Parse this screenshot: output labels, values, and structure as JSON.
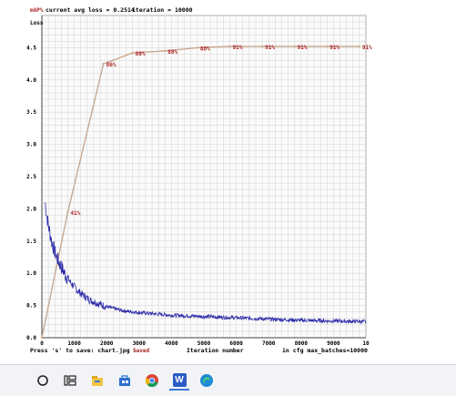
{
  "chart_data": {
    "type": "line",
    "header": {
      "current_avg_loss": "current avg loss = 0.2514",
      "iteration": "iteration = 10000"
    },
    "legend": {
      "map": "mAP%",
      "loss": "Loss"
    },
    "x_ticks": [
      "0",
      "1000",
      "2000",
      "3000",
      "4000",
      "5000",
      "6000",
      "7000",
      "8000",
      "9000",
      "10"
    ],
    "y_ticks": [
      "0.0",
      "0.5",
      "1.0",
      "1.5",
      "2.0",
      "2.5",
      "3.0",
      "3.5",
      "4.0",
      "4.5"
    ],
    "xlim": [
      0,
      10000
    ],
    "ylim": [
      0,
      5
    ],
    "footer": {
      "press": "Press 's' to save: chart.jpg - ",
      "saved": "Saved",
      "xlabel": "Iteration number",
      "max_batches": "in cfg max_batches=10000"
    },
    "map_series": {
      "name": "mAP%",
      "x": [
        0,
        800,
        1900,
        2800,
        3800,
        4800,
        5800,
        6800,
        7800,
        8800,
        9800
      ],
      "y": [
        0.0,
        1.95,
        4.25,
        4.42,
        4.45,
        4.5,
        4.52,
        4.52,
        4.52,
        4.52,
        4.52
      ],
      "labels": [
        "",
        "41%",
        "86%",
        "88%",
        "88%",
        "88%",
        "91%",
        "91%",
        "91%",
        "91%",
        "91%"
      ]
    },
    "loss_series": {
      "name": "Loss",
      "x": [
        100,
        150,
        200,
        300,
        400,
        500,
        700,
        900,
        1100,
        1300,
        1500,
        1800,
        2000,
        2500,
        3000,
        3500,
        4000,
        5000,
        6000,
        7000,
        8000,
        9000,
        10000
      ],
      "y": [
        2.1,
        1.9,
        1.75,
        1.5,
        1.33,
        1.2,
        1.0,
        0.85,
        0.73,
        0.65,
        0.58,
        0.52,
        0.48,
        0.42,
        0.39,
        0.37,
        0.35,
        0.33,
        0.31,
        0.29,
        0.27,
        0.26,
        0.25
      ]
    },
    "colors": {
      "map_line": "#c8a890",
      "map_label": "#b02020",
      "loss_line": "#2a2aa8",
      "grid": "#c8c8c8"
    },
    "grid": true
  },
  "taskbar": {
    "icons": [
      "search-circle-icon",
      "task-view-icon",
      "file-explorer-icon",
      "store-icon",
      "chrome-icon",
      "word-icon",
      "edge-icon"
    ],
    "word_letter": "W"
  }
}
